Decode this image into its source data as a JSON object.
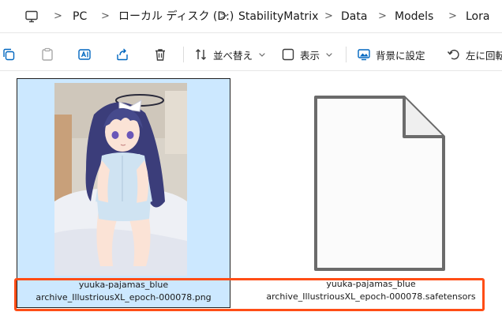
{
  "address_bar": {
    "pc_icon": "monitor-icon",
    "segments": [
      "PC",
      "ローカル ディスク (D:)",
      "StabilityMatrix",
      "Data",
      "Models",
      "Lora"
    ],
    "separator": ">"
  },
  "toolbar": {
    "copy_icon": "copy-icon",
    "paste_icon": "paste-icon",
    "rename_icon": "rename-icon",
    "share_icon": "share-icon",
    "delete_icon": "trash-icon",
    "sort_label": "並べ替え",
    "view_label": "表示",
    "set_bg_label": "背景に設定",
    "rotate_label": "左に回転"
  },
  "files": [
    {
      "name_line1": "yuuka-pajamas_blue",
      "name_line2": "archive_IllustriousXL_epoch-000078.png",
      "selected": true,
      "type_icon": "image-thumbnail"
    },
    {
      "name_line1": "yuuka-pajamas_blue",
      "name_line2": "archive_IllustriousXL_epoch-000078.safetensors",
      "selected": false,
      "type_icon": "generic-file-icon"
    }
  ],
  "colors": {
    "selection_bg": "#cce8ff",
    "highlight_border": "#ff4d16"
  }
}
